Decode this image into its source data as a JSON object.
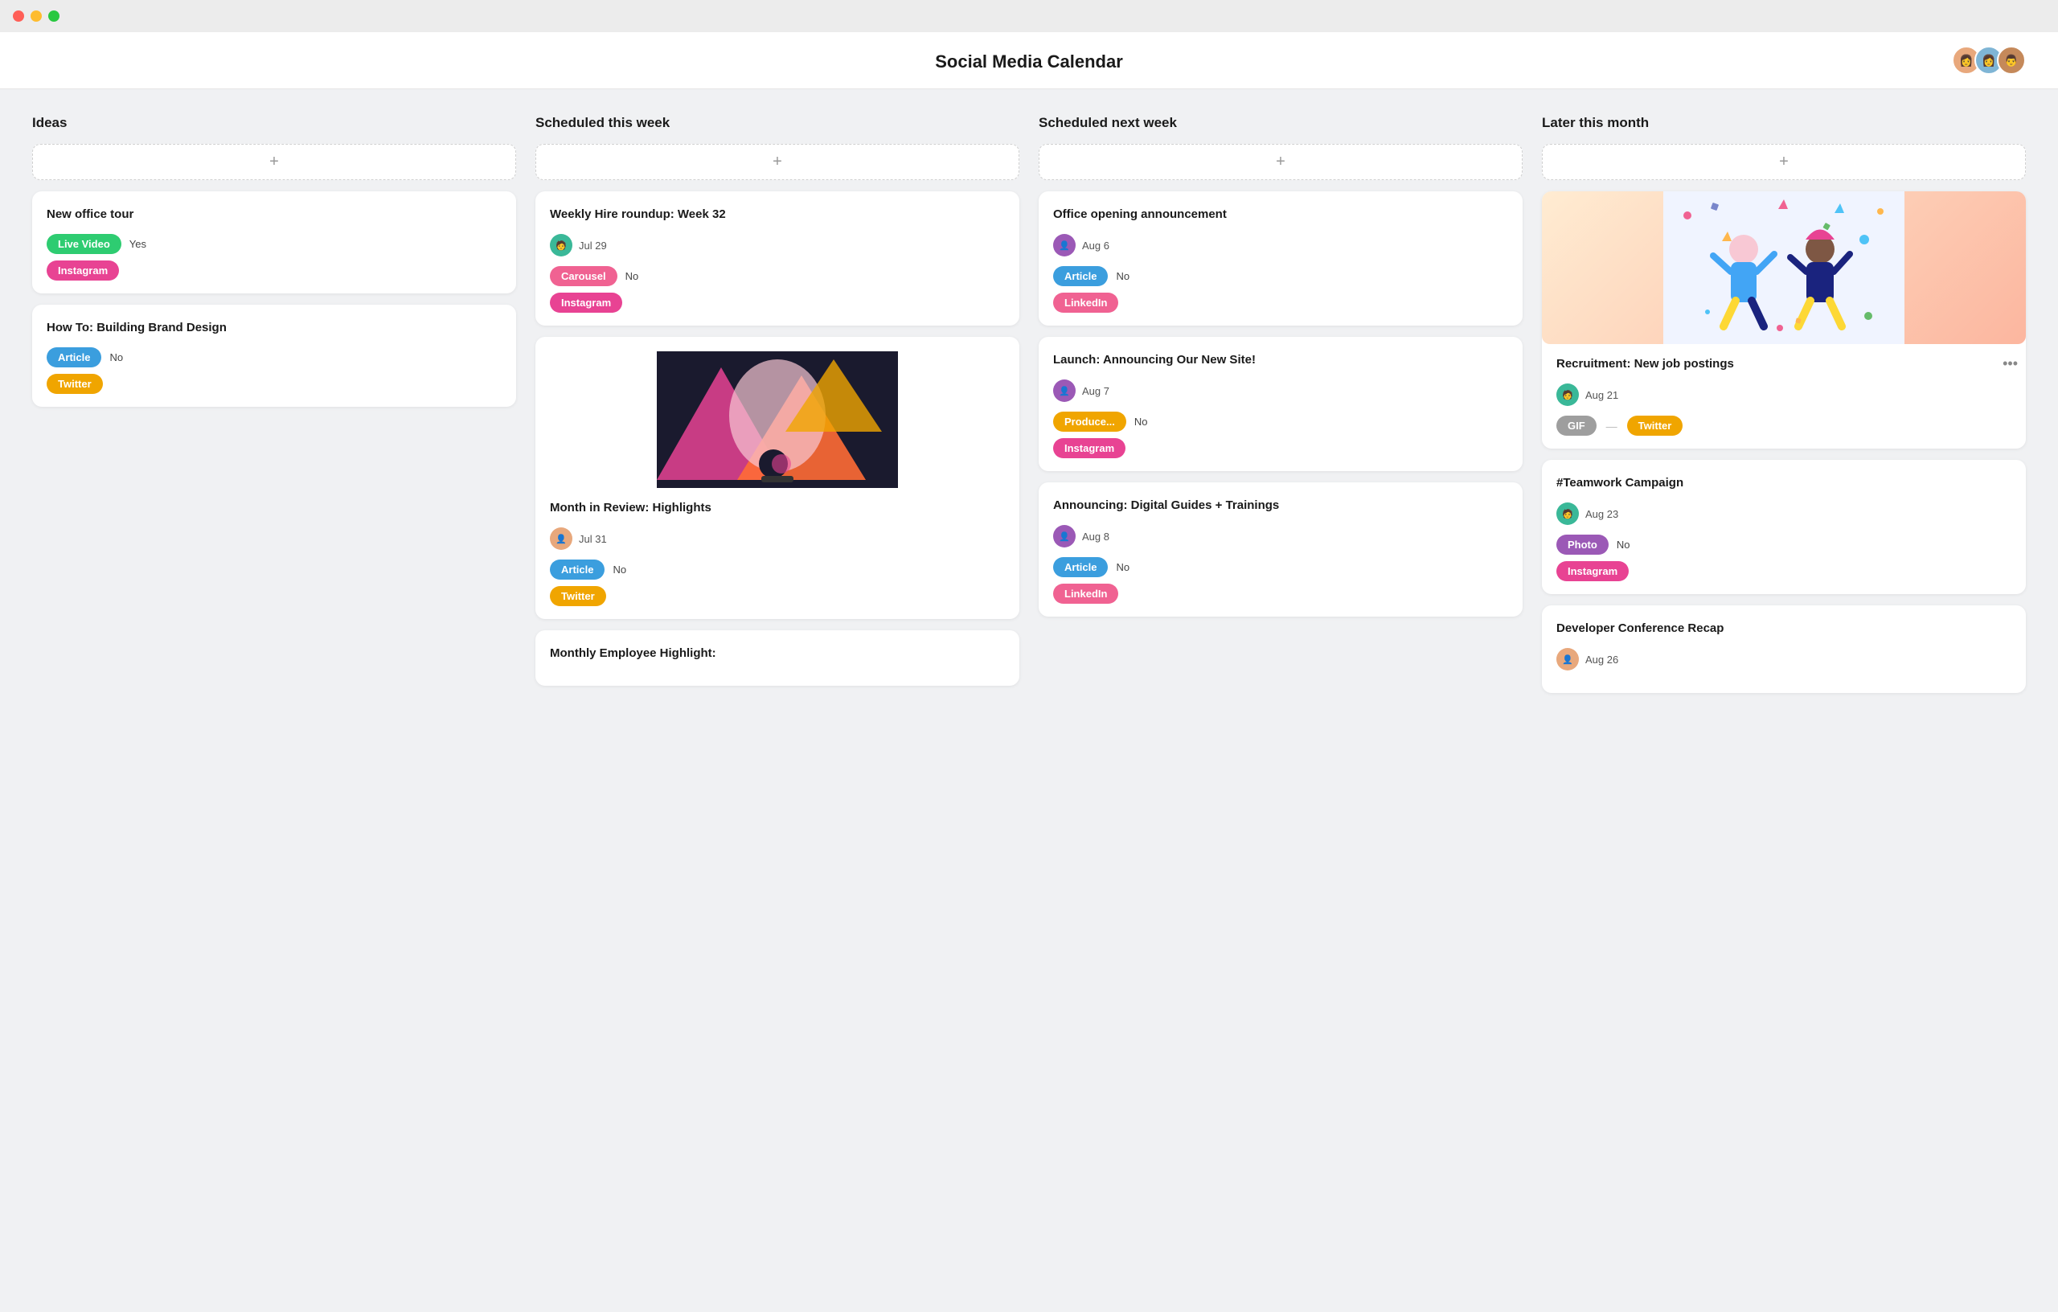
{
  "app": {
    "title": "Social Media Calendar"
  },
  "columns": [
    {
      "id": "ideas",
      "title": "Ideas",
      "cards": [
        {
          "id": "new-office-tour",
          "title": "New office tour",
          "tags": [
            {
              "label": "Live Video",
              "type": "live-video"
            },
            {
              "label": "Yes",
              "type": "text"
            },
            {
              "label": "Instagram",
              "type": "instagram"
            }
          ]
        },
        {
          "id": "building-brand",
          "title": "How To: Building Brand Design",
          "tags": [
            {
              "label": "Article",
              "type": "article"
            },
            {
              "label": "No",
              "type": "text"
            },
            {
              "label": "Twitter",
              "type": "twitter"
            }
          ]
        }
      ]
    },
    {
      "id": "scheduled-this-week",
      "title": "Scheduled this week",
      "cards": [
        {
          "id": "weekly-hire",
          "title": "Weekly Hire roundup: Week 32",
          "avatar_color": "#3ab898",
          "date": "Jul 29",
          "tags": [
            {
              "label": "Carousel",
              "type": "carousel"
            },
            {
              "label": "No",
              "type": "text"
            },
            {
              "label": "Instagram",
              "type": "instagram"
            }
          ],
          "has_image": false
        },
        {
          "id": "month-in-review",
          "title": "Month in Review: Highlights",
          "avatar_color": "#e8a87c",
          "date": "Jul 31",
          "tags": [
            {
              "label": "Article",
              "type": "article"
            },
            {
              "label": "No",
              "type": "text"
            },
            {
              "label": "Twitter",
              "type": "twitter"
            }
          ],
          "has_image": true
        },
        {
          "id": "monthly-employee",
          "title": "Monthly Employee Highlight:",
          "has_image": false,
          "partial": true
        }
      ]
    },
    {
      "id": "scheduled-next-week",
      "title": "Scheduled next week",
      "cards": [
        {
          "id": "office-opening",
          "title": "Office opening announcement",
          "avatar_color": "#9b59b6",
          "date": "Aug 6",
          "tags": [
            {
              "label": "Article",
              "type": "article"
            },
            {
              "label": "No",
              "type": "text"
            },
            {
              "label": "LinkedIn",
              "type": "linkedin"
            }
          ]
        },
        {
          "id": "new-site",
          "title": "Launch: Announcing Our New Site!",
          "avatar_color": "#9b59b6",
          "date": "Aug 7",
          "tags": [
            {
              "label": "Produce...",
              "type": "produce"
            },
            {
              "label": "No",
              "type": "text"
            },
            {
              "label": "Instagram",
              "type": "instagram"
            }
          ]
        },
        {
          "id": "digital-guides",
          "title": "Announcing: Digital Guides + Trainings",
          "avatar_color": "#9b59b6",
          "date": "Aug 8",
          "tags": [
            {
              "label": "Article",
              "type": "article"
            },
            {
              "label": "No",
              "type": "text"
            },
            {
              "label": "LinkedIn",
              "type": "linkedin"
            }
          ],
          "has_image": false
        }
      ]
    },
    {
      "id": "later-this-month",
      "title": "Later this month",
      "cards": [
        {
          "id": "recruitment",
          "title": "Recruitment: New job postings",
          "avatar_color": "#3ab898",
          "date": "Aug 21",
          "tags": [
            {
              "label": "GIF",
              "type": "gif"
            },
            {
              "dash": true
            },
            {
              "label": "Twitter",
              "type": "twitter"
            }
          ],
          "has_celebration": true
        },
        {
          "id": "teamwork-campaign",
          "title": "#Teamwork Campaign",
          "avatar_color": "#3ab898",
          "date": "Aug 23",
          "tags": [
            {
              "label": "Photo",
              "type": "photo"
            },
            {
              "label": "No",
              "type": "text"
            },
            {
              "label": "Instagram",
              "type": "instagram"
            }
          ]
        },
        {
          "id": "dev-conference",
          "title": "Developer Conference Recap",
          "avatar_color": "#e8a87c",
          "date": "Aug 26",
          "partial": true
        }
      ]
    }
  ],
  "add_button_label": "+",
  "more_options_label": "•••"
}
